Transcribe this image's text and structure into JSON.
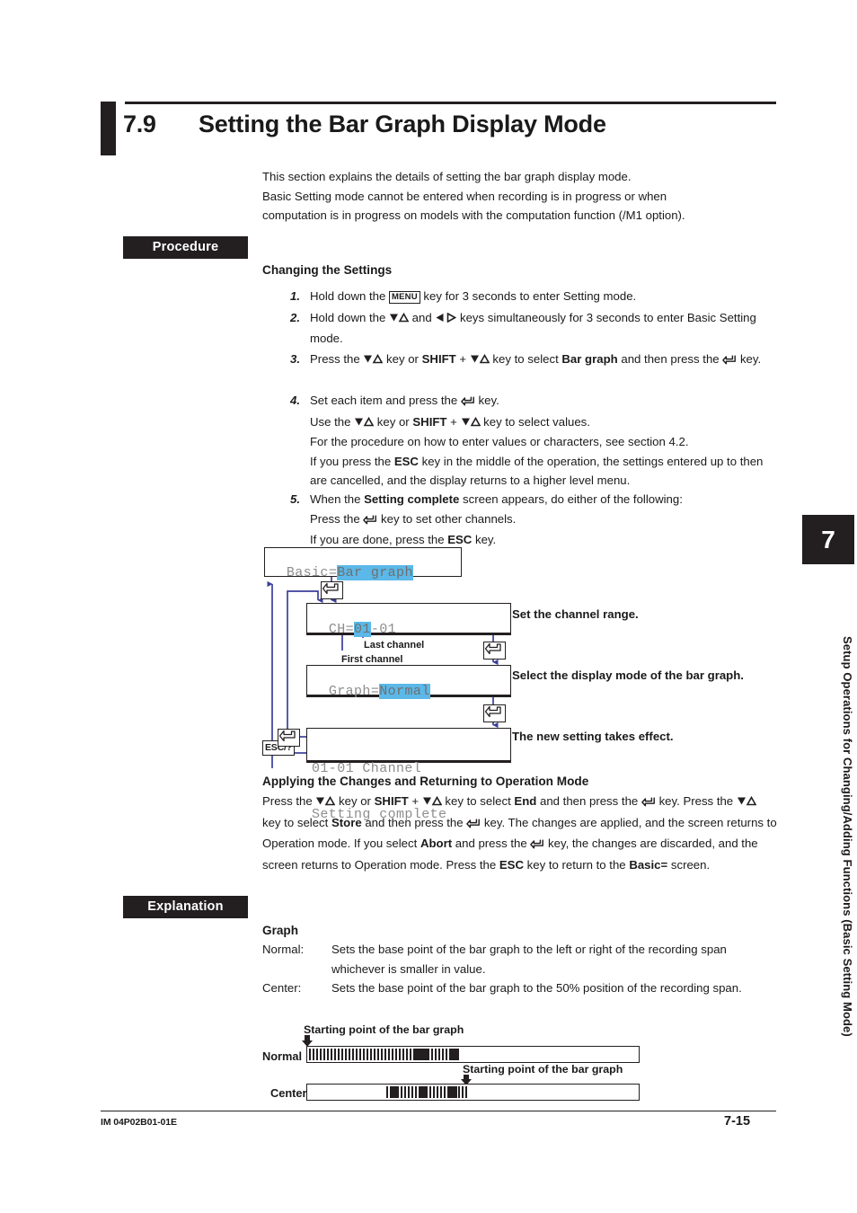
{
  "page": {
    "section_number": "7.9",
    "section_title": "Setting the Bar Graph Display Mode",
    "intro_line1": "This section explains the details of setting the bar graph display mode.",
    "intro_line2": "Basic Setting mode cannot be entered when recording is in progress or when",
    "intro_line3": "computation is in progress on models with the computation function (/M1 option).",
    "footer_left": "IM 04P02B01-01E",
    "footer_right": "7-15"
  },
  "tags": {
    "procedure": "Procedure",
    "explanation": "Explanation"
  },
  "headings": {
    "changing": "Changing the Settings",
    "applying": "Applying the Changes and Returning to Operation Mode",
    "graph": "Graph"
  },
  "steps": [
    {
      "num": "1.",
      "parts": [
        {
          "t": "text",
          "v": "Hold down the "
        },
        {
          "t": "keycap",
          "v": "MENU"
        },
        {
          "t": "text",
          "v": " key for 3 seconds to enter Setting mode."
        }
      ]
    },
    {
      "num": "2.",
      "parts": [
        {
          "t": "text",
          "v": "Hold down the "
        },
        {
          "t": "updown",
          "v": "▽△"
        },
        {
          "t": "text",
          "v": " and "
        },
        {
          "t": "leftright",
          "v": "◁ ▷"
        },
        {
          "t": "text",
          "v": " keys simultaneously for 3 seconds to enter Basic Setting mode."
        }
      ]
    },
    {
      "num": "3.",
      "parts": [
        {
          "t": "text",
          "v": "Press the "
        },
        {
          "t": "updown",
          "v": "▽△"
        },
        {
          "t": "text",
          "v": " key or "
        },
        {
          "t": "bold",
          "v": "SHIFT"
        },
        {
          "t": "text",
          "v": " + "
        },
        {
          "t": "updown",
          "v": "▽△"
        },
        {
          "t": "text",
          "v": " key to select "
        },
        {
          "t": "bold",
          "v": "Bar graph"
        },
        {
          "t": "text",
          "v": " and then press the "
        },
        {
          "t": "enter",
          "v": "↵"
        },
        {
          "t": "text",
          "v": " key."
        }
      ]
    },
    {
      "num": "4.",
      "parts": [
        {
          "t": "text",
          "v": "Set each item and press the "
        },
        {
          "t": "enter",
          "v": "↵"
        },
        {
          "t": "text",
          "v": " key."
        },
        {
          "t": "br",
          "v": ""
        },
        {
          "t": "text",
          "v": "Use the "
        },
        {
          "t": "updown",
          "v": "▽△"
        },
        {
          "t": "text",
          "v": " key or "
        },
        {
          "t": "bold",
          "v": "SHIFT"
        },
        {
          "t": "text",
          "v": " + "
        },
        {
          "t": "updown",
          "v": "▽△"
        },
        {
          "t": "text",
          "v": " key to select values."
        },
        {
          "t": "br",
          "v": ""
        },
        {
          "t": "text",
          "v": "For the procedure on how to enter values or characters, see section 4.2."
        },
        {
          "t": "br",
          "v": ""
        },
        {
          "t": "text",
          "v": "If you press the "
        },
        {
          "t": "bold",
          "v": "ESC"
        },
        {
          "t": "text",
          "v": " key in the middle of the operation, the settings entered up to then are cancelled, and the display returns to a higher level menu."
        }
      ]
    },
    {
      "num": "5.",
      "parts": [
        {
          "t": "text",
          "v": "When the "
        },
        {
          "t": "bold",
          "v": "Setting complete"
        },
        {
          "t": "text",
          "v": " screen appears, do either of the following:"
        },
        {
          "t": "br",
          "v": ""
        },
        {
          "t": "text",
          "v": "Press the "
        },
        {
          "t": "enter",
          "v": "↵"
        },
        {
          "t": "text",
          "v": " key to set other channels."
        },
        {
          "t": "br",
          "v": ""
        },
        {
          "t": "text",
          "v": "If you are done, press the "
        },
        {
          "t": "bold",
          "v": "ESC"
        },
        {
          "t": "text",
          "v": " key."
        }
      ]
    }
  ],
  "diagram": {
    "screens": {
      "basic": {
        "prefix": "Basic=",
        "highlight": "Bar graph"
      },
      "channel": {
        "prefix": "CH=",
        "highlight": "01",
        "suffix": "-01"
      },
      "graph": {
        "prefix": "Graph=",
        "highlight": "Normal"
      },
      "complete_line1": "01-01 Channel",
      "complete_line2": "Setting complete"
    },
    "esc_key_label": "ESC/?",
    "channel_labels": {
      "last": "Last channel",
      "first": "First channel"
    },
    "annotations": [
      "Set the channel range.",
      "Select the display mode of the bar graph.",
      "The new setting takes effect."
    ],
    "highlight_color": "#5bb8e8",
    "arrow_color": "#3b3f99"
  },
  "applying": {
    "parts": [
      {
        "t": "text",
        "v": "Press the "
      },
      {
        "t": "updown",
        "v": "▽△"
      },
      {
        "t": "text",
        "v": " key or "
      },
      {
        "t": "bold",
        "v": "SHIFT"
      },
      {
        "t": "text",
        "v": " + "
      },
      {
        "t": "updown",
        "v": "▽△"
      },
      {
        "t": "text",
        "v": " key to select "
      },
      {
        "t": "bold",
        "v": "End"
      },
      {
        "t": "text",
        "v": " and then press the "
      },
      {
        "t": "enter",
        "v": "↵"
      },
      {
        "t": "text",
        "v": " key. Press the "
      },
      {
        "t": "updown",
        "v": "▽△"
      },
      {
        "t": "text",
        "v": " key to select "
      },
      {
        "t": "bold",
        "v": "Store"
      },
      {
        "t": "text",
        "v": " and then press the "
      },
      {
        "t": "enter",
        "v": "↵"
      },
      {
        "t": "text",
        "v": " key. The changes are applied, and the screen returns to Operation mode. If you select "
      },
      {
        "t": "bold",
        "v": "Abort"
      },
      {
        "t": "text",
        "v": " and press the "
      },
      {
        "t": "enter",
        "v": "↵"
      },
      {
        "t": "text",
        "v": " key, the changes are discarded, and the screen returns to Operation mode. Press the "
      },
      {
        "t": "bold",
        "v": "ESC"
      },
      {
        "t": "text",
        "v": " key to return to the "
      },
      {
        "t": "bold",
        "v": "Basic="
      },
      {
        "t": "text",
        "v": " screen."
      }
    ]
  },
  "definitions": [
    {
      "term": "Normal:",
      "desc": "Sets the base point of the bar graph to the left or right of the recording span whichever is smaller in value."
    },
    {
      "term": "Center:",
      "desc": "Sets the base point of the bar graph to the 50% position of the recording span."
    }
  ],
  "bargraph_figure": {
    "caption_1": "Starting point of the bar graph",
    "caption_2": "Starting point of the bar graph",
    "label_normal": "Normal",
    "label_center": "Center"
  },
  "chapter": {
    "number": "7",
    "title": "Setup Operations for Changing/Adding Functions (Basic Setting Mode)"
  }
}
